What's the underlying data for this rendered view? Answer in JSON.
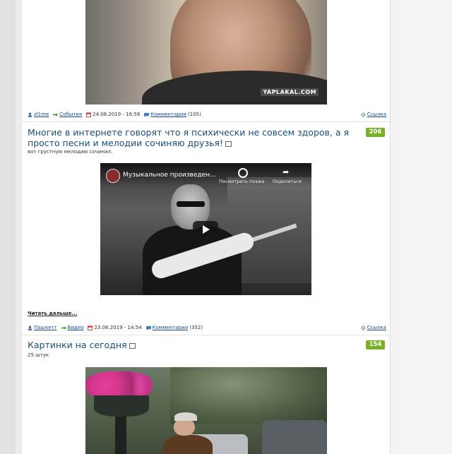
{
  "post1": {
    "watermark": "YAPLAKAL.COM",
    "meta": {
      "author": "zl1me",
      "category": "События",
      "date": "24.06.2019 - 16:58",
      "comments_label": "Комментарии",
      "comments_count": "(105)",
      "link_label": "Ссылка"
    }
  },
  "post2": {
    "title": "Многие в интернете говорят что я психически не совсем здоров, а я просто песни и мелодии сочиняю друзья!",
    "score": "206",
    "subtext": "вот грустную мелодию сочинил.",
    "video": {
      "title": "Музыкальное произведен...",
      "watch_later": "Посмотреть позже",
      "share": "Поделиться"
    },
    "read_more": "Читать дальше...",
    "meta": {
      "author": "Пашкетт",
      "category": "Видео",
      "date": "23.06.2019 - 14:54",
      "comments_label": "Комментарии",
      "comments_count": "(352)",
      "link_label": "Ссылка"
    }
  },
  "post3": {
    "title": "Картинки на сегодня",
    "score": "154",
    "subtext": "25 штук"
  },
  "colors": {
    "title": "#1a4e7a",
    "score_bg": "#7ab226",
    "link": "#1a4e8a"
  },
  "icons": [
    "user-icon",
    "arrow-right-icon",
    "calendar-icon",
    "comment-icon",
    "share-link-icon",
    "external-link-icon",
    "play-icon",
    "clock-icon",
    "share-icon"
  ]
}
